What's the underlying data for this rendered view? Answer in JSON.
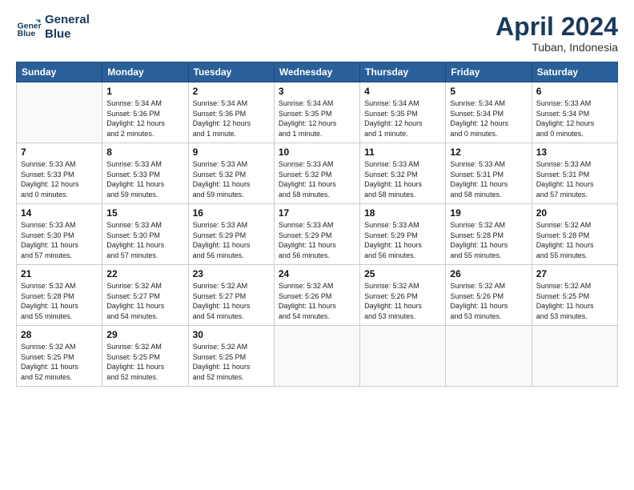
{
  "header": {
    "logo_line1": "General",
    "logo_line2": "Blue",
    "month_title": "April 2024",
    "location": "Tuban, Indonesia"
  },
  "weekdays": [
    "Sunday",
    "Monday",
    "Tuesday",
    "Wednesday",
    "Thursday",
    "Friday",
    "Saturday"
  ],
  "weeks": [
    [
      {
        "day": "",
        "info": ""
      },
      {
        "day": "1",
        "info": "Sunrise: 5:34 AM\nSunset: 5:36 PM\nDaylight: 12 hours\nand 2 minutes."
      },
      {
        "day": "2",
        "info": "Sunrise: 5:34 AM\nSunset: 5:36 PM\nDaylight: 12 hours\nand 1 minute."
      },
      {
        "day": "3",
        "info": "Sunrise: 5:34 AM\nSunset: 5:35 PM\nDaylight: 12 hours\nand 1 minute."
      },
      {
        "day": "4",
        "info": "Sunrise: 5:34 AM\nSunset: 5:35 PM\nDaylight: 12 hours\nand 1 minute."
      },
      {
        "day": "5",
        "info": "Sunrise: 5:34 AM\nSunset: 5:34 PM\nDaylight: 12 hours\nand 0 minutes."
      },
      {
        "day": "6",
        "info": "Sunrise: 5:33 AM\nSunset: 5:34 PM\nDaylight: 12 hours\nand 0 minutes."
      }
    ],
    [
      {
        "day": "7",
        "info": "Sunrise: 5:33 AM\nSunset: 5:33 PM\nDaylight: 12 hours\nand 0 minutes."
      },
      {
        "day": "8",
        "info": "Sunrise: 5:33 AM\nSunset: 5:33 PM\nDaylight: 11 hours\nand 59 minutes."
      },
      {
        "day": "9",
        "info": "Sunrise: 5:33 AM\nSunset: 5:32 PM\nDaylight: 11 hours\nand 59 minutes."
      },
      {
        "day": "10",
        "info": "Sunrise: 5:33 AM\nSunset: 5:32 PM\nDaylight: 11 hours\nand 58 minutes."
      },
      {
        "day": "11",
        "info": "Sunrise: 5:33 AM\nSunset: 5:32 PM\nDaylight: 11 hours\nand 58 minutes."
      },
      {
        "day": "12",
        "info": "Sunrise: 5:33 AM\nSunset: 5:31 PM\nDaylight: 11 hours\nand 58 minutes."
      },
      {
        "day": "13",
        "info": "Sunrise: 5:33 AM\nSunset: 5:31 PM\nDaylight: 11 hours\nand 57 minutes."
      }
    ],
    [
      {
        "day": "14",
        "info": "Sunrise: 5:33 AM\nSunset: 5:30 PM\nDaylight: 11 hours\nand 57 minutes."
      },
      {
        "day": "15",
        "info": "Sunrise: 5:33 AM\nSunset: 5:30 PM\nDaylight: 11 hours\nand 57 minutes."
      },
      {
        "day": "16",
        "info": "Sunrise: 5:33 AM\nSunset: 5:29 PM\nDaylight: 11 hours\nand 56 minutes."
      },
      {
        "day": "17",
        "info": "Sunrise: 5:33 AM\nSunset: 5:29 PM\nDaylight: 11 hours\nand 56 minutes."
      },
      {
        "day": "18",
        "info": "Sunrise: 5:33 AM\nSunset: 5:29 PM\nDaylight: 11 hours\nand 56 minutes."
      },
      {
        "day": "19",
        "info": "Sunrise: 5:32 AM\nSunset: 5:28 PM\nDaylight: 11 hours\nand 55 minutes."
      },
      {
        "day": "20",
        "info": "Sunrise: 5:32 AM\nSunset: 5:28 PM\nDaylight: 11 hours\nand 55 minutes."
      }
    ],
    [
      {
        "day": "21",
        "info": "Sunrise: 5:32 AM\nSunset: 5:28 PM\nDaylight: 11 hours\nand 55 minutes."
      },
      {
        "day": "22",
        "info": "Sunrise: 5:32 AM\nSunset: 5:27 PM\nDaylight: 11 hours\nand 54 minutes."
      },
      {
        "day": "23",
        "info": "Sunrise: 5:32 AM\nSunset: 5:27 PM\nDaylight: 11 hours\nand 54 minutes."
      },
      {
        "day": "24",
        "info": "Sunrise: 5:32 AM\nSunset: 5:26 PM\nDaylight: 11 hours\nand 54 minutes."
      },
      {
        "day": "25",
        "info": "Sunrise: 5:32 AM\nSunset: 5:26 PM\nDaylight: 11 hours\nand 53 minutes."
      },
      {
        "day": "26",
        "info": "Sunrise: 5:32 AM\nSunset: 5:26 PM\nDaylight: 11 hours\nand 53 minutes."
      },
      {
        "day": "27",
        "info": "Sunrise: 5:32 AM\nSunset: 5:25 PM\nDaylight: 11 hours\nand 53 minutes."
      }
    ],
    [
      {
        "day": "28",
        "info": "Sunrise: 5:32 AM\nSunset: 5:25 PM\nDaylight: 11 hours\nand 52 minutes."
      },
      {
        "day": "29",
        "info": "Sunrise: 5:32 AM\nSunset: 5:25 PM\nDaylight: 11 hours\nand 52 minutes."
      },
      {
        "day": "30",
        "info": "Sunrise: 5:32 AM\nSunset: 5:25 PM\nDaylight: 11 hours\nand 52 minutes."
      },
      {
        "day": "",
        "info": ""
      },
      {
        "day": "",
        "info": ""
      },
      {
        "day": "",
        "info": ""
      },
      {
        "day": "",
        "info": ""
      }
    ]
  ]
}
